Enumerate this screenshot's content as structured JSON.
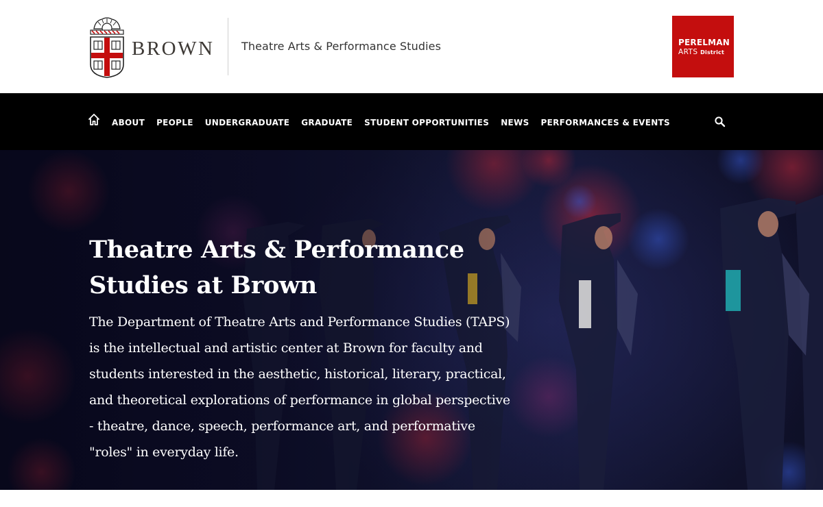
{
  "header": {
    "logo_wordmark": "BROWN",
    "department_title": "Theatre Arts & Performance Studies",
    "perelman": {
      "line1": "PERELMAN",
      "line2": "ARTS",
      "line3": "District"
    }
  },
  "nav": {
    "home_icon": "home-icon",
    "items": [
      {
        "label": "ABOUT"
      },
      {
        "label": "PEOPLE"
      },
      {
        "label": "UNDERGRADUATE"
      },
      {
        "label": "GRADUATE"
      },
      {
        "label": "STUDENT OPPORTUNITIES"
      },
      {
        "label": "NEWS"
      },
      {
        "label": "PERFORMANCES & EVENTS"
      }
    ],
    "search_icon": "search-icon"
  },
  "hero": {
    "title": "Theatre Arts & Performance Studies at Brown",
    "description": "The Department of Theatre Arts and Performance Studies (TAPS) is the intellectual and artistic center at Brown for faculty and students interested in the aesthetic, historical, literary, practical, and theoretical explorations of performance in global perspective - theatre, dance, speech, performance art, and performative \"roles\" in everyday life."
  },
  "colors": {
    "brown_red": "#c40e0e",
    "nav_background": "#000000",
    "hero_background": "#10102e",
    "text_dark": "#333333"
  }
}
